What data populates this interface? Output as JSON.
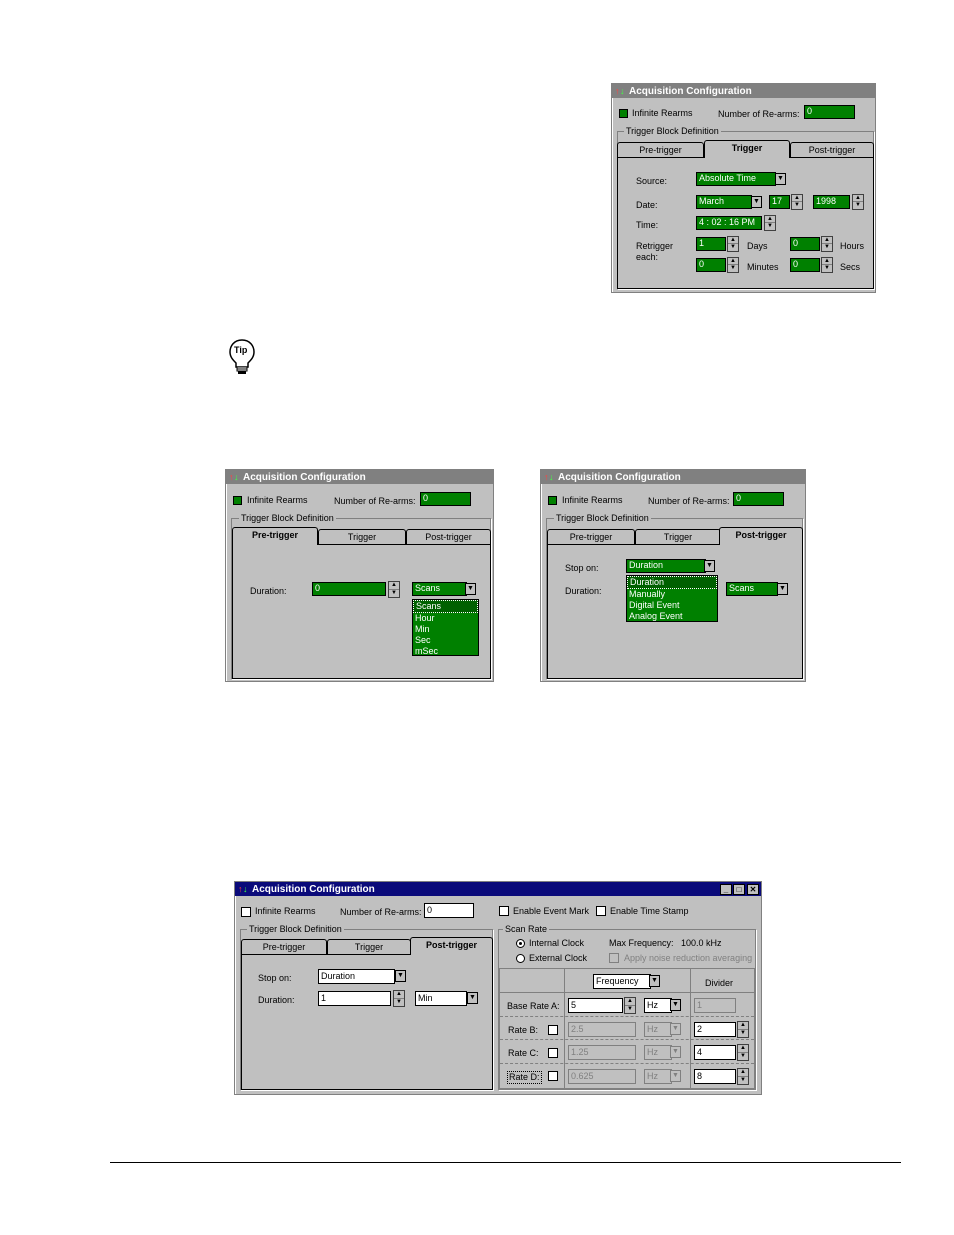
{
  "win1": {
    "title": "Acquisition Configuration",
    "infinite_rearms": "Infinite Rearms",
    "num_rearms_label": "Number of Re-arms:",
    "num_rearms_value": "0",
    "group_label": "Trigger Block Definition",
    "tabs": [
      "Pre-trigger",
      "Trigger",
      "Post-trigger"
    ],
    "source_label": "Source:",
    "source_value": "Absolute Time",
    "date_label": "Date:",
    "date_month": "March",
    "date_day": "17",
    "date_year": "1998",
    "time_label": "Time:",
    "time_value": "4 : 02 : 16 PM",
    "retrigger_label_1": "Retrigger",
    "retrigger_label_2": "each:",
    "days_value": "1",
    "days_label": "Days",
    "hours_value": "0",
    "hours_label": "Hours",
    "minutes_value": "0",
    "minutes_label": "Minutes",
    "secs_value": "0",
    "secs_label": "Secs"
  },
  "tip": {
    "label": "Tip"
  },
  "win2": {
    "title": "Acquisition Configuration",
    "infinite_rearms": "Infinite Rearms",
    "num_rearms_label": "Number of Re-arms:",
    "num_rearms_value": "0",
    "group_label": "Trigger Block Definition",
    "tabs": [
      "Pre-trigger",
      "Trigger",
      "Post-trigger"
    ],
    "duration_label": "Duration:",
    "duration_value": "0",
    "units_value": "Scans",
    "units_options": [
      "Scans",
      "Hour",
      "Min",
      "Sec",
      "mSec"
    ]
  },
  "win3": {
    "title": "Acquisition Configuration",
    "infinite_rearms": "Infinite Rearms",
    "num_rearms_label": "Number of Re-arms:",
    "num_rearms_value": "0",
    "group_label": "Trigger Block Definition",
    "tabs": [
      "Pre-trigger",
      "Trigger",
      "Post-trigger"
    ],
    "stop_on_label": "Stop on:",
    "stop_on_value": "Duration",
    "stop_on_options": [
      "Duration",
      "Manually",
      "Digital Event",
      "Analog Event"
    ],
    "duration_label": "Duration:",
    "units_value": "Scans"
  },
  "win4": {
    "title": "Acquisition Configuration",
    "infinite_rearms": "Infinite Rearms",
    "num_rearms_label": "Number of Re-arms:",
    "num_rearms_value": "0",
    "enable_event_mark": "Enable Event Mark",
    "enable_time_stamp": "Enable Time Stamp",
    "group_label": "Trigger Block Definition",
    "tabs": [
      "Pre-trigger",
      "Trigger",
      "Post-trigger"
    ],
    "stop_on_label": "Stop on:",
    "stop_on_value": "Duration",
    "duration_label": "Duration:",
    "duration_value": "1",
    "duration_units": "Min",
    "scan_rate_label": "Scan Rate",
    "internal_clock": "Internal Clock",
    "external_clock": "External Clock",
    "max_freq_label": "Max Frequency:",
    "max_freq_value": "100.0 kHz",
    "noise_reduction": "Apply noise reduction averaging",
    "column_select": "Frequency",
    "divider_label": "Divider",
    "rates": [
      {
        "label": "Base Rate A:",
        "value": "5",
        "unit": "Hz",
        "divider": "1"
      },
      {
        "label": "Rate B:",
        "value": "2.5",
        "unit": "Hz",
        "divider": "2"
      },
      {
        "label": "Rate C:",
        "value": "1.25",
        "unit": "Hz",
        "divider": "4"
      },
      {
        "label": "Rate D:",
        "value": "0.625",
        "unit": "Hz",
        "divider": "8"
      }
    ]
  }
}
